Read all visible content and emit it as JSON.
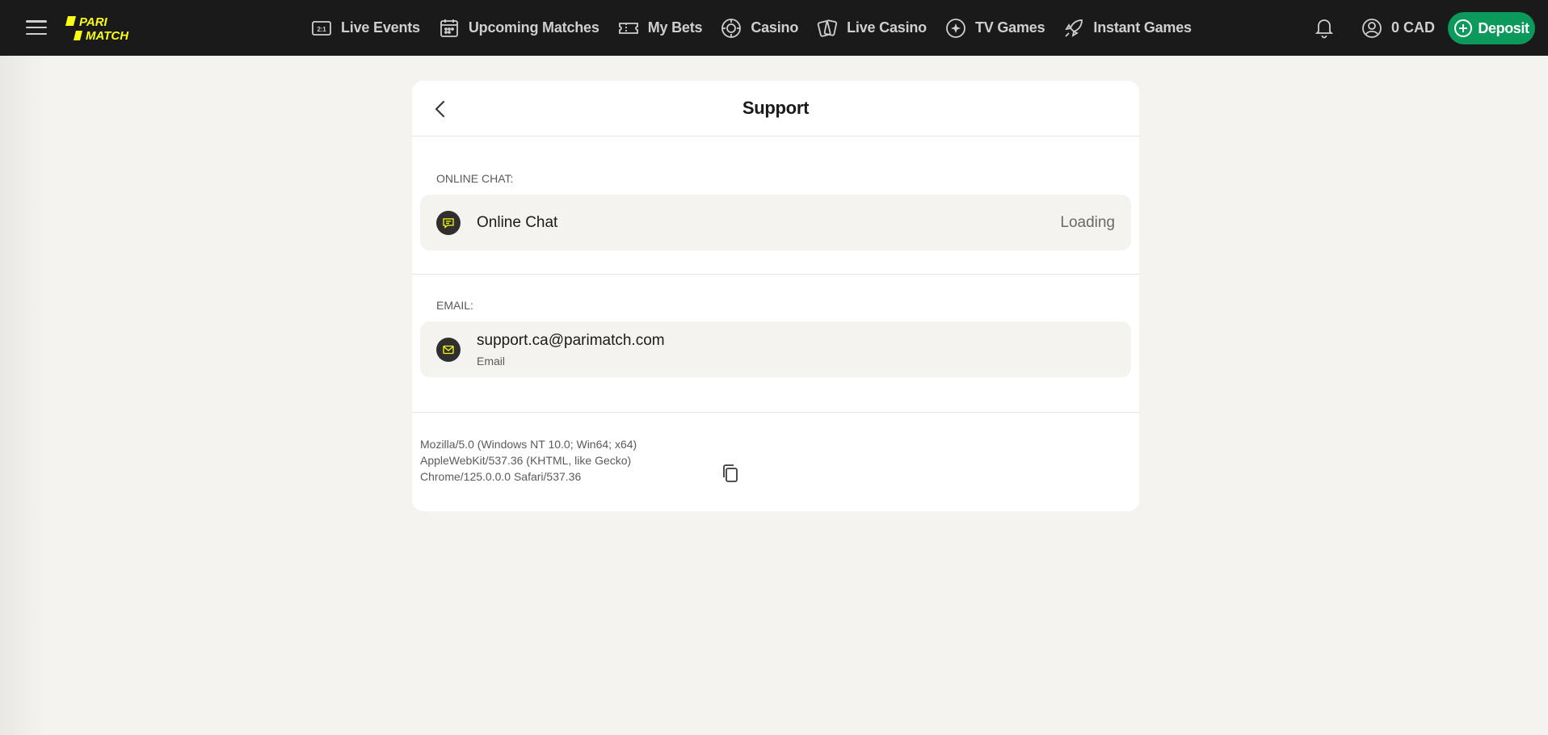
{
  "header": {
    "logo_text": "PARI MATCH",
    "nav": [
      {
        "label": "Live Events",
        "icon": "live-events-icon"
      },
      {
        "label": "Upcoming Matches",
        "icon": "calendar-icon"
      },
      {
        "label": "My Bets",
        "icon": "ticket-icon"
      },
      {
        "label": "Casino",
        "icon": "chip-icon"
      },
      {
        "label": "Live Casino",
        "icon": "cards-icon"
      },
      {
        "label": "TV Games",
        "icon": "sparkle-icon"
      },
      {
        "label": "Instant Games",
        "icon": "rocket-icon"
      }
    ],
    "balance": "0 CAD",
    "deposit_label": "Deposit"
  },
  "support": {
    "title": "Support",
    "chat_section_label": "ONLINE CHAT:",
    "chat_title": "Online Chat",
    "chat_status": "Loading",
    "email_section_label": "EMAIL:",
    "email_address": "support.ca@parimatch.com",
    "email_sub": "Email",
    "user_agent_lines": [
      "Mozilla/5.0 (Windows NT 10.0; Win64; x64)",
      "AppleWebKit/537.36 (KHTML, like Gecko)",
      "Chrome/125.0.0.0 Safari/537.36"
    ]
  },
  "colors": {
    "topbar": "#1a1a1a",
    "brand_yellow": "#f8ff13",
    "deposit_green": "#0b9a5c",
    "page_bg": "#f4f3ef"
  }
}
